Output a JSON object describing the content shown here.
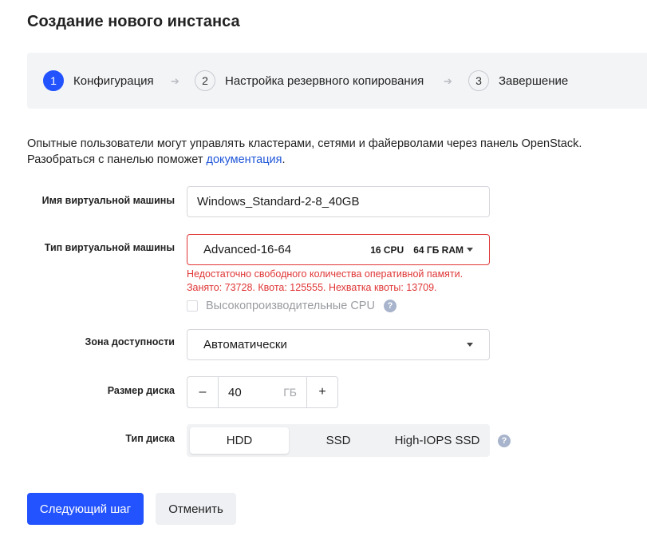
{
  "page": {
    "title": "Создание нового инстанса"
  },
  "steps": [
    {
      "num": "1",
      "label": "Конфигурация",
      "active": true
    },
    {
      "num": "2",
      "label": "Настройка резервного копирования",
      "active": false
    },
    {
      "num": "3",
      "label": "Завершение",
      "active": false
    }
  ],
  "intro": {
    "line1": "Опытные пользователи могут управлять кластерами, сетями и файерволами через панель OpenStack.",
    "line2_prefix": "Разобраться с панелью поможет ",
    "link": "документация",
    "line2_suffix": "."
  },
  "form": {
    "vm_name": {
      "label": "Имя виртуальной машины",
      "value": "Windows_Standard-2-8_40GB"
    },
    "vm_type": {
      "label": "Тип виртуальной машины",
      "value": "Advanced-16-64",
      "cpu": "16 CPU",
      "ram": "64 ГБ RAM",
      "error_line1": "Недостаточно свободного количества оперативной памяти.",
      "error_line2": "Занято: 73728. Квота: 125555. Нехватка квоты: 13709.",
      "checkbox_label": "Высокопроизводительные CPU",
      "help": "?"
    },
    "zone": {
      "label": "Зона доступности",
      "value": "Автоматически"
    },
    "disk_size": {
      "label": "Размер диска",
      "minus": "–",
      "value": "40",
      "unit": "ГБ",
      "plus": "+"
    },
    "disk_type": {
      "label": "Тип диска",
      "options": [
        "HDD",
        "SSD",
        "High-IOPS SSD"
      ],
      "selected": "HDD",
      "help": "?"
    }
  },
  "actions": {
    "next": "Следующий шаг",
    "cancel": "Отменить"
  },
  "colors": {
    "accent": "#2353ff",
    "error": "#e03535",
    "link": "#1f56d8"
  },
  "icons": {
    "step_arrow": "arrow-right-icon",
    "caret": "chevron-down-icon",
    "help": "question-circle-icon"
  }
}
